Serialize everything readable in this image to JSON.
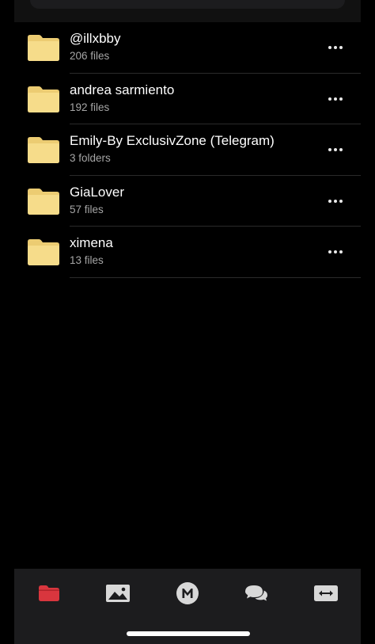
{
  "folders": [
    {
      "name": "@illxbby",
      "meta": "206 files"
    },
    {
      "name": "andrea sarmiento",
      "meta": "192 files"
    },
    {
      "name": "Emily-By ExclusivZone (Telegram)",
      "meta": "3 folders"
    },
    {
      "name": "GiaLover",
      "meta": "57 files"
    },
    {
      "name": "ximena",
      "meta": "13 files"
    }
  ],
  "icons": {
    "folder": "folder-icon",
    "more": "more-options-icon"
  },
  "tabbar": {
    "tabs": [
      {
        "icon": "cloud-drive-folder-icon",
        "active": true
      },
      {
        "icon": "photos-icon",
        "active": false
      },
      {
        "icon": "mega-logo-icon",
        "active": false
      },
      {
        "icon": "chat-icon",
        "active": false
      },
      {
        "icon": "transfers-icon",
        "active": false
      }
    ]
  },
  "colors": {
    "background": "#000000",
    "folder": "#f6dc8a",
    "folder_tab": "#eccc72",
    "active_tab": "#d9363e",
    "inactive_tab": "#d8d8d8",
    "tabbar": "#1c1c1e",
    "secondary_text": "#a6a6a6"
  }
}
